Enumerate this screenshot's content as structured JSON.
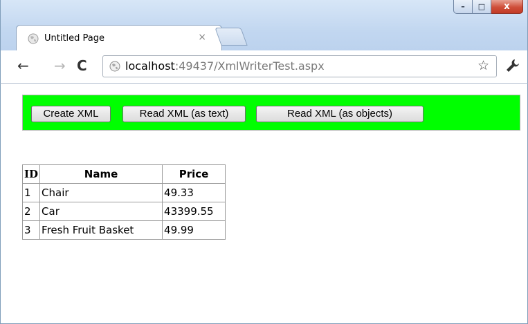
{
  "browser": {
    "tab": {
      "title": "Untitled Page",
      "close_glyph": "×"
    },
    "window_controls": {
      "minimize": "–",
      "maximize": "□",
      "close": "x"
    },
    "nav": {
      "back": "←",
      "forward": "→",
      "reload": "C"
    },
    "address": {
      "host": "localhost",
      "rest": ":49437/XmlWriterTest.aspx"
    },
    "bookmark_star": "☆"
  },
  "page": {
    "panel_color": "#00ff00",
    "buttons": {
      "create": "Create XML",
      "read_text": "Read XML (as text)",
      "read_objects": "Read XML (as objects)"
    },
    "table": {
      "headers": {
        "id": "ID",
        "name": "Name",
        "price": "Price"
      },
      "rows": [
        {
          "id": "1",
          "name": "Chair",
          "price": "49.33"
        },
        {
          "id": "2",
          "name": "Car",
          "price": "43399.55"
        },
        {
          "id": "3",
          "name": "Fresh Fruit Basket",
          "price": "49.99"
        }
      ]
    }
  }
}
